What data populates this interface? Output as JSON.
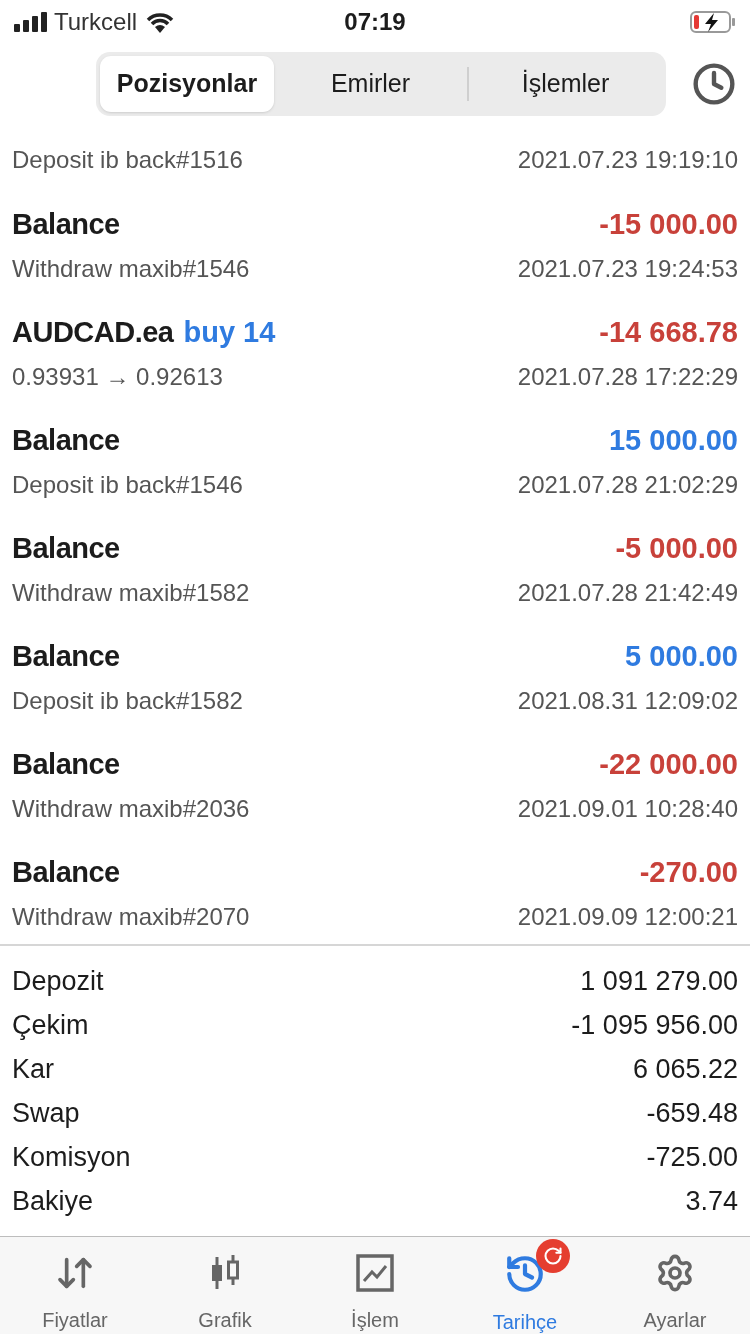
{
  "status_bar": {
    "carrier": "Turkcell",
    "time": "07:19"
  },
  "segments": [
    {
      "label": "Pozisyonlar",
      "selected": true
    },
    {
      "label": "Emirler",
      "selected": false
    },
    {
      "label": "İşlemler",
      "selected": false
    }
  ],
  "partial_row": {
    "subtitle": "Deposit ib back#1516",
    "time": "2021.07.23 19:19:10"
  },
  "rows": [
    {
      "title": "Balance",
      "amount": "-15 000.00",
      "color": "#c8413a",
      "subtitle": "Withdraw maxib#1546",
      "time": "2021.07.23 19:24:53"
    },
    {
      "title": "AUDCAD.ea",
      "action": "buy 14",
      "amount": "-14 668.78",
      "color": "#c8413a",
      "subtitle": "0.93931 → 0.92613",
      "time": "2021.07.28 17:22:29"
    },
    {
      "title": "Balance",
      "amount": "15 000.00",
      "color": "#2f7be0",
      "subtitle": "Deposit ib back#1546",
      "time": "2021.07.28 21:02:29"
    },
    {
      "title": "Balance",
      "amount": "-5 000.00",
      "color": "#c8413a",
      "subtitle": "Withdraw maxib#1582",
      "time": "2021.07.28 21:42:49"
    },
    {
      "title": "Balance",
      "amount": "5 000.00",
      "color": "#2f7be0",
      "subtitle": "Deposit ib back#1582",
      "time": "2021.08.31 12:09:02"
    },
    {
      "title": "Balance",
      "amount": "-22 000.00",
      "color": "#c8413a",
      "subtitle": "Withdraw maxib#2036",
      "time": "2021.09.01 10:28:40"
    },
    {
      "title": "Balance",
      "amount": "-270.00",
      "color": "#c8413a",
      "subtitle": "Withdraw maxib#2070",
      "time": "2021.09.09 12:00:21"
    }
  ],
  "summary": [
    {
      "label": "Depozit",
      "value": "1 091 279.00"
    },
    {
      "label": "Çekim",
      "value": "-1 095 956.00"
    },
    {
      "label": "Kar",
      "value": "6 065.22"
    },
    {
      "label": "Swap",
      "value": "-659.48"
    },
    {
      "label": "Komisyon",
      "value": "-725.00"
    },
    {
      "label": "Bakiye",
      "value": "3.74"
    }
  ],
  "tab_bar": [
    {
      "label": "Fiyatlar",
      "selected": false,
      "badge": false
    },
    {
      "label": "Grafik",
      "selected": false,
      "badge": false
    },
    {
      "label": "İşlem",
      "selected": false,
      "badge": false
    },
    {
      "label": "Tarihçe",
      "selected": true,
      "badge": true
    },
    {
      "label": "Ayarlar",
      "selected": false,
      "badge": false
    }
  ]
}
